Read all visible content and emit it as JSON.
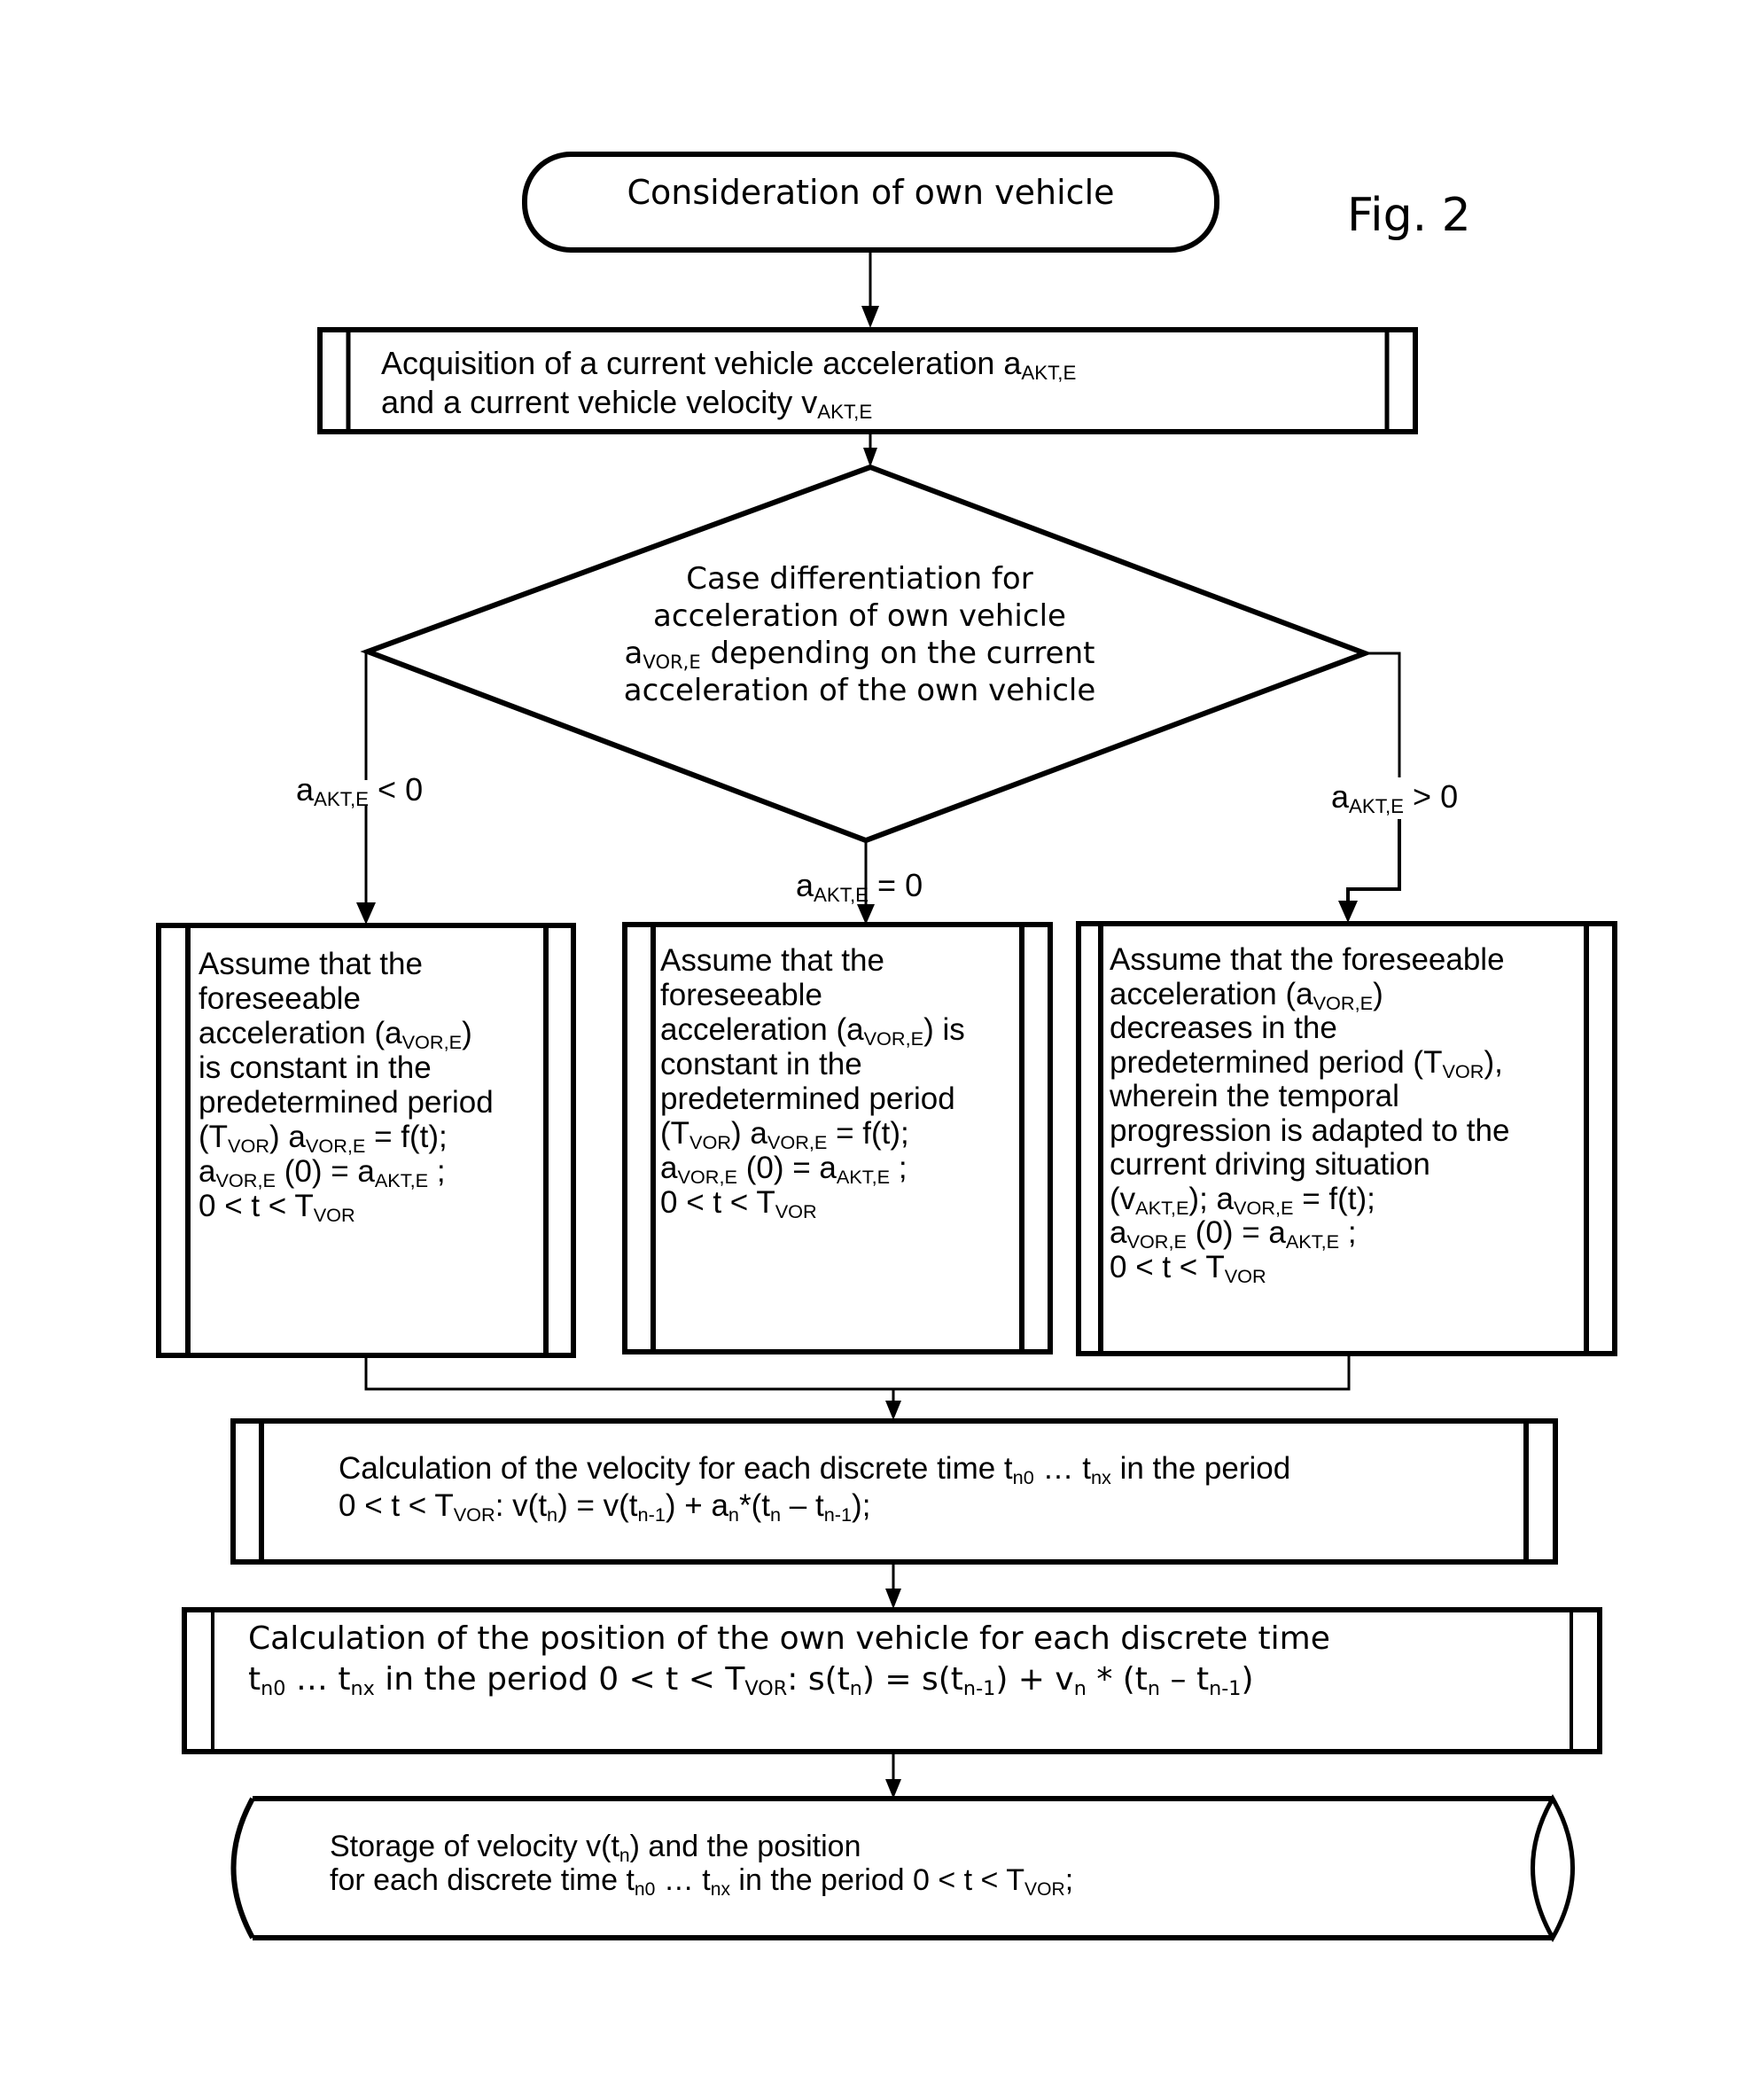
{
  "figure": {
    "label": "Fig. 2",
    "type": "flowchart",
    "colors": {
      "line": "#000000",
      "background": "#ffffff"
    }
  },
  "start": {
    "text": "Consideration of own vehicle"
  },
  "acquisition": {
    "line1": {
      "text": "Acquisition of a current vehicle acceleration a",
      "sub": "AKT,E"
    },
    "line2": {
      "text": "and a current vehicle velocity v",
      "sub": "AKT,E"
    }
  },
  "decision": {
    "line1": "Case differentiation for",
    "line2": "acceleration of own vehicle",
    "line3_var": "a",
    "line3_sub": "VOR,E",
    "line3_rest": " depending on the current",
    "line4": "acceleration of the own vehicle"
  },
  "branches": {
    "left": {
      "var": "a",
      "sub": "AKT,E",
      "op": " < 0"
    },
    "middle": {
      "var": "a",
      "sub": "AKT,E",
      "op": " = 0"
    },
    "right": {
      "var": "a",
      "sub": "AKT,E",
      "op": " > 0"
    }
  },
  "case_boxes": {
    "left": {
      "l1": "Assume that the",
      "l2": "foreseeable",
      "l3a": "acceleration (a",
      "l3s": "VOR,E",
      "l3b": ")",
      "l4": "is constant in the",
      "l5": "predetermined period",
      "l6a": "(T",
      "l6s": "VOR",
      "l6b": ") a",
      "l6s2": "VOR,E",
      "l6c": " = f(t);",
      "l7a": "a",
      "l7s": "VOR,E",
      "l7b": " (0) =  a",
      "l7s2": "AKT,E",
      "l7c": " ;",
      "l8a": "0 < t < T",
      "l8s": "VOR"
    },
    "middle": {
      "l1": "Assume that the",
      "l2": "foreseeable",
      "l3a": "acceleration (a",
      "l3s": "VOR,E",
      "l3b": ") is",
      "l4": "constant in the",
      "l5": "predetermined period",
      "l6a": "(T",
      "l6s": "VOR",
      "l6b": ") a",
      "l6s2": "VOR,E",
      "l6c": " = f(t);",
      "l7a": "a",
      "l7s": "VOR,E",
      "l7b": " (0) = a",
      "l7s2": "AKT,E",
      "l7c": " ;",
      "l8a": "0 < t < T",
      "l8s": "VOR"
    },
    "right": {
      "l1": "Assume that the foreseeable",
      "l2a": "acceleration (a",
      "l2s": "VOR,E",
      "l2b": ")",
      "l3": "decreases in the",
      "l4a": "predetermined period (T",
      "l4s": "VOR",
      "l4b": "),",
      "l5": "wherein the temporal",
      "l6": "progression is adapted to the",
      "l7": "current driving situation",
      "l8a": "(v",
      "l8s": "AKT,E",
      "l8b": "); a",
      "l8s2": "VOR,E",
      "l8c": " = f(t);",
      "l9a": "a",
      "l9s": "VOR,E",
      "l9b": " (0) = a",
      "l9s2": "AKT,E",
      "l9c": " ;",
      "l10a": "0 < t < T",
      "l10s": "VOR"
    }
  },
  "velocity_calc": {
    "l1a": "Calculation of the velocity for each discrete time t",
    "l1s": "n0",
    "l1b": " … t",
    "l1s2": "nx",
    "l1c": " in the period",
    "l2a": "0 < t < T",
    "l2s": "VOR",
    "l2b": ": v(t",
    "l2s2": "n",
    "l2c": ") = v(t",
    "l2s3": "n-1",
    "l2d": ") + a",
    "l2s4": "n",
    "l2e": "*(t",
    "l2s5": "n",
    "l2f": " – t",
    "l2s6": "n-1",
    "l2g": ");"
  },
  "position_calc": {
    "l1": "Calculation of the position of the own vehicle for each discrete time",
    "l2a": "t",
    "l2s": "n0",
    "l2b": " … t",
    "l2s2": "nx",
    "l2c": " in the period 0 < t < T",
    "l2s3": "VOR",
    "l2d": ": s(t",
    "l2s4": "n",
    "l2e": ") = s(t",
    "l2s5": "n-1",
    "l2f": ") + v",
    "l2s6": "n",
    "l2g": " * (t",
    "l2s7": "n",
    "l2h": " – t",
    "l2s8": "n-1",
    "l2i": ")"
  },
  "storage": {
    "l1a": "Storage of velocity v(t",
    "l1s": "n",
    "l1b": ") and the position",
    "l2a": "for each discrete time t",
    "l2s": "n0",
    "l2b": " … t",
    "l2s2": "nx",
    "l2c": " in the period 0 < t < T",
    "l2s3": "VOR",
    "l2d": ";"
  }
}
